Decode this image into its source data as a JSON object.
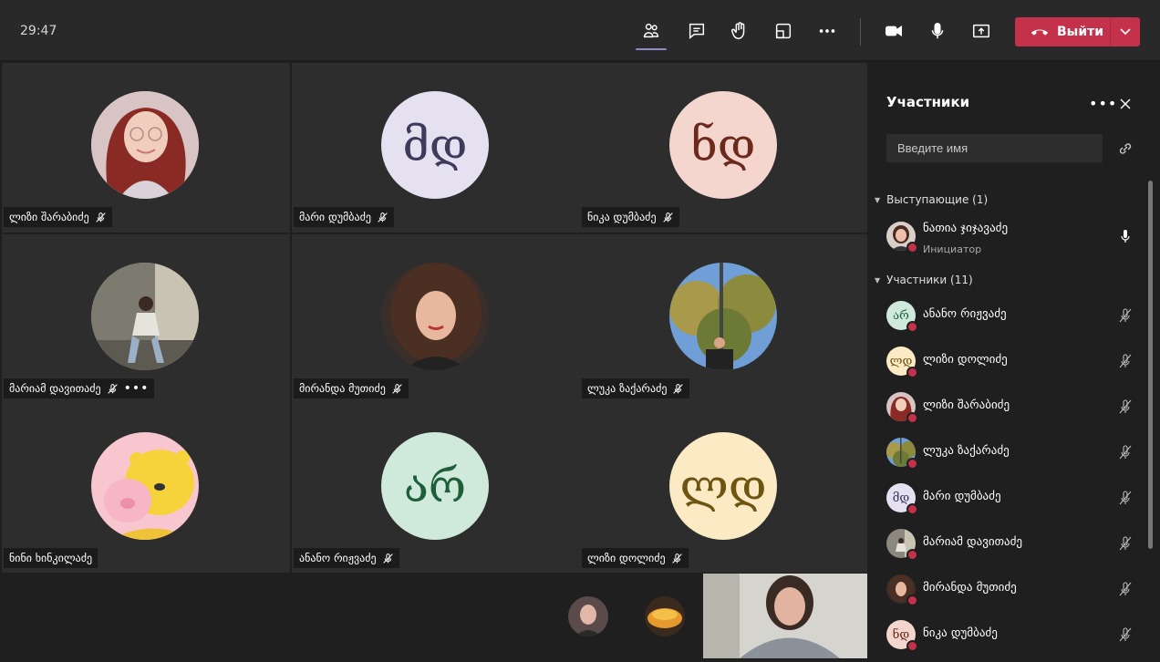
{
  "toolbar": {
    "timer": "29:47",
    "leave_label": "Выйти"
  },
  "tiles": [
    {
      "name": "ლიზი შარაბიძე",
      "avatar_type": "photo-girl-glasses",
      "muted": true
    },
    {
      "name": "მარი დუმბაძე",
      "avatar_initials": "მდ",
      "avatar_bg": "#e5e1f0",
      "avatar_fg": "#3d3a5c",
      "muted": true
    },
    {
      "name": "ნიკა დუმბაძე",
      "avatar_initials": "ნდ",
      "avatar_bg": "#f4d6cf",
      "avatar_fg": "#6b2a1c",
      "muted": true
    },
    {
      "name": "მარიამ დავითაძე",
      "avatar_type": "photo-girl-sitting",
      "muted": true,
      "more": "•••"
    },
    {
      "name": "მირანდა მუთიძე",
      "avatar_type": "photo-girl-curly",
      "muted": true
    },
    {
      "name": "ლუკა ზაქარაძე",
      "avatar_type": "photo-trees",
      "muted": true
    },
    {
      "name": "ნინი ხინკილაძე",
      "avatar_type": "photo-pooh",
      "muted": false
    },
    {
      "name": "ანანო რიჟვაძე",
      "avatar_initials": "არ",
      "avatar_bg": "#cfeadb",
      "avatar_fg": "#1f5e3a",
      "muted": true
    },
    {
      "name": "ლიზი დოლიძე",
      "avatar_initials": "ლდ",
      "avatar_bg": "#fbeac4",
      "avatar_fg": "#6d5410",
      "muted": true
    }
  ],
  "panel": {
    "title": "Участники",
    "more": "•••",
    "search_placeholder": "Введите имя",
    "presenters_header": "Выступающие (1)",
    "participants_header": "Участники (11)",
    "presenter": {
      "name": "ნათია ჯიჯავაძე",
      "role": "Инициатор"
    },
    "participants": [
      {
        "name": "ანანო რიჟვაძე",
        "initials": "არ",
        "bg": "#cfeadb",
        "fg": "#1f5e3a"
      },
      {
        "name": "ლიზი დოლიძე",
        "initials": "ლდ",
        "bg": "#fbeac4",
        "fg": "#6d5410"
      },
      {
        "name": "ლიზი შარაბიძე",
        "photo": "girl-glasses"
      },
      {
        "name": "ლუკა ზაქარაძე",
        "photo": "trees"
      },
      {
        "name": "მარი დუმბაძე",
        "initials": "მდ",
        "bg": "#e5e1f0",
        "fg": "#3d3a5c"
      },
      {
        "name": "მარიამ დავითაძე",
        "photo": "girl-sitting"
      },
      {
        "name": "მირანდა მუთიძე",
        "photo": "girl-curly"
      },
      {
        "name": "ნიკა დუმბაძე",
        "initials": "ნდ",
        "bg": "#f4d6cf",
        "fg": "#6b2a1c"
      }
    ]
  },
  "colors": {
    "leave": "#c4314b",
    "accent": "#8b8cc7",
    "tile": "#2d2d2d",
    "background": "#1f1f1f"
  }
}
